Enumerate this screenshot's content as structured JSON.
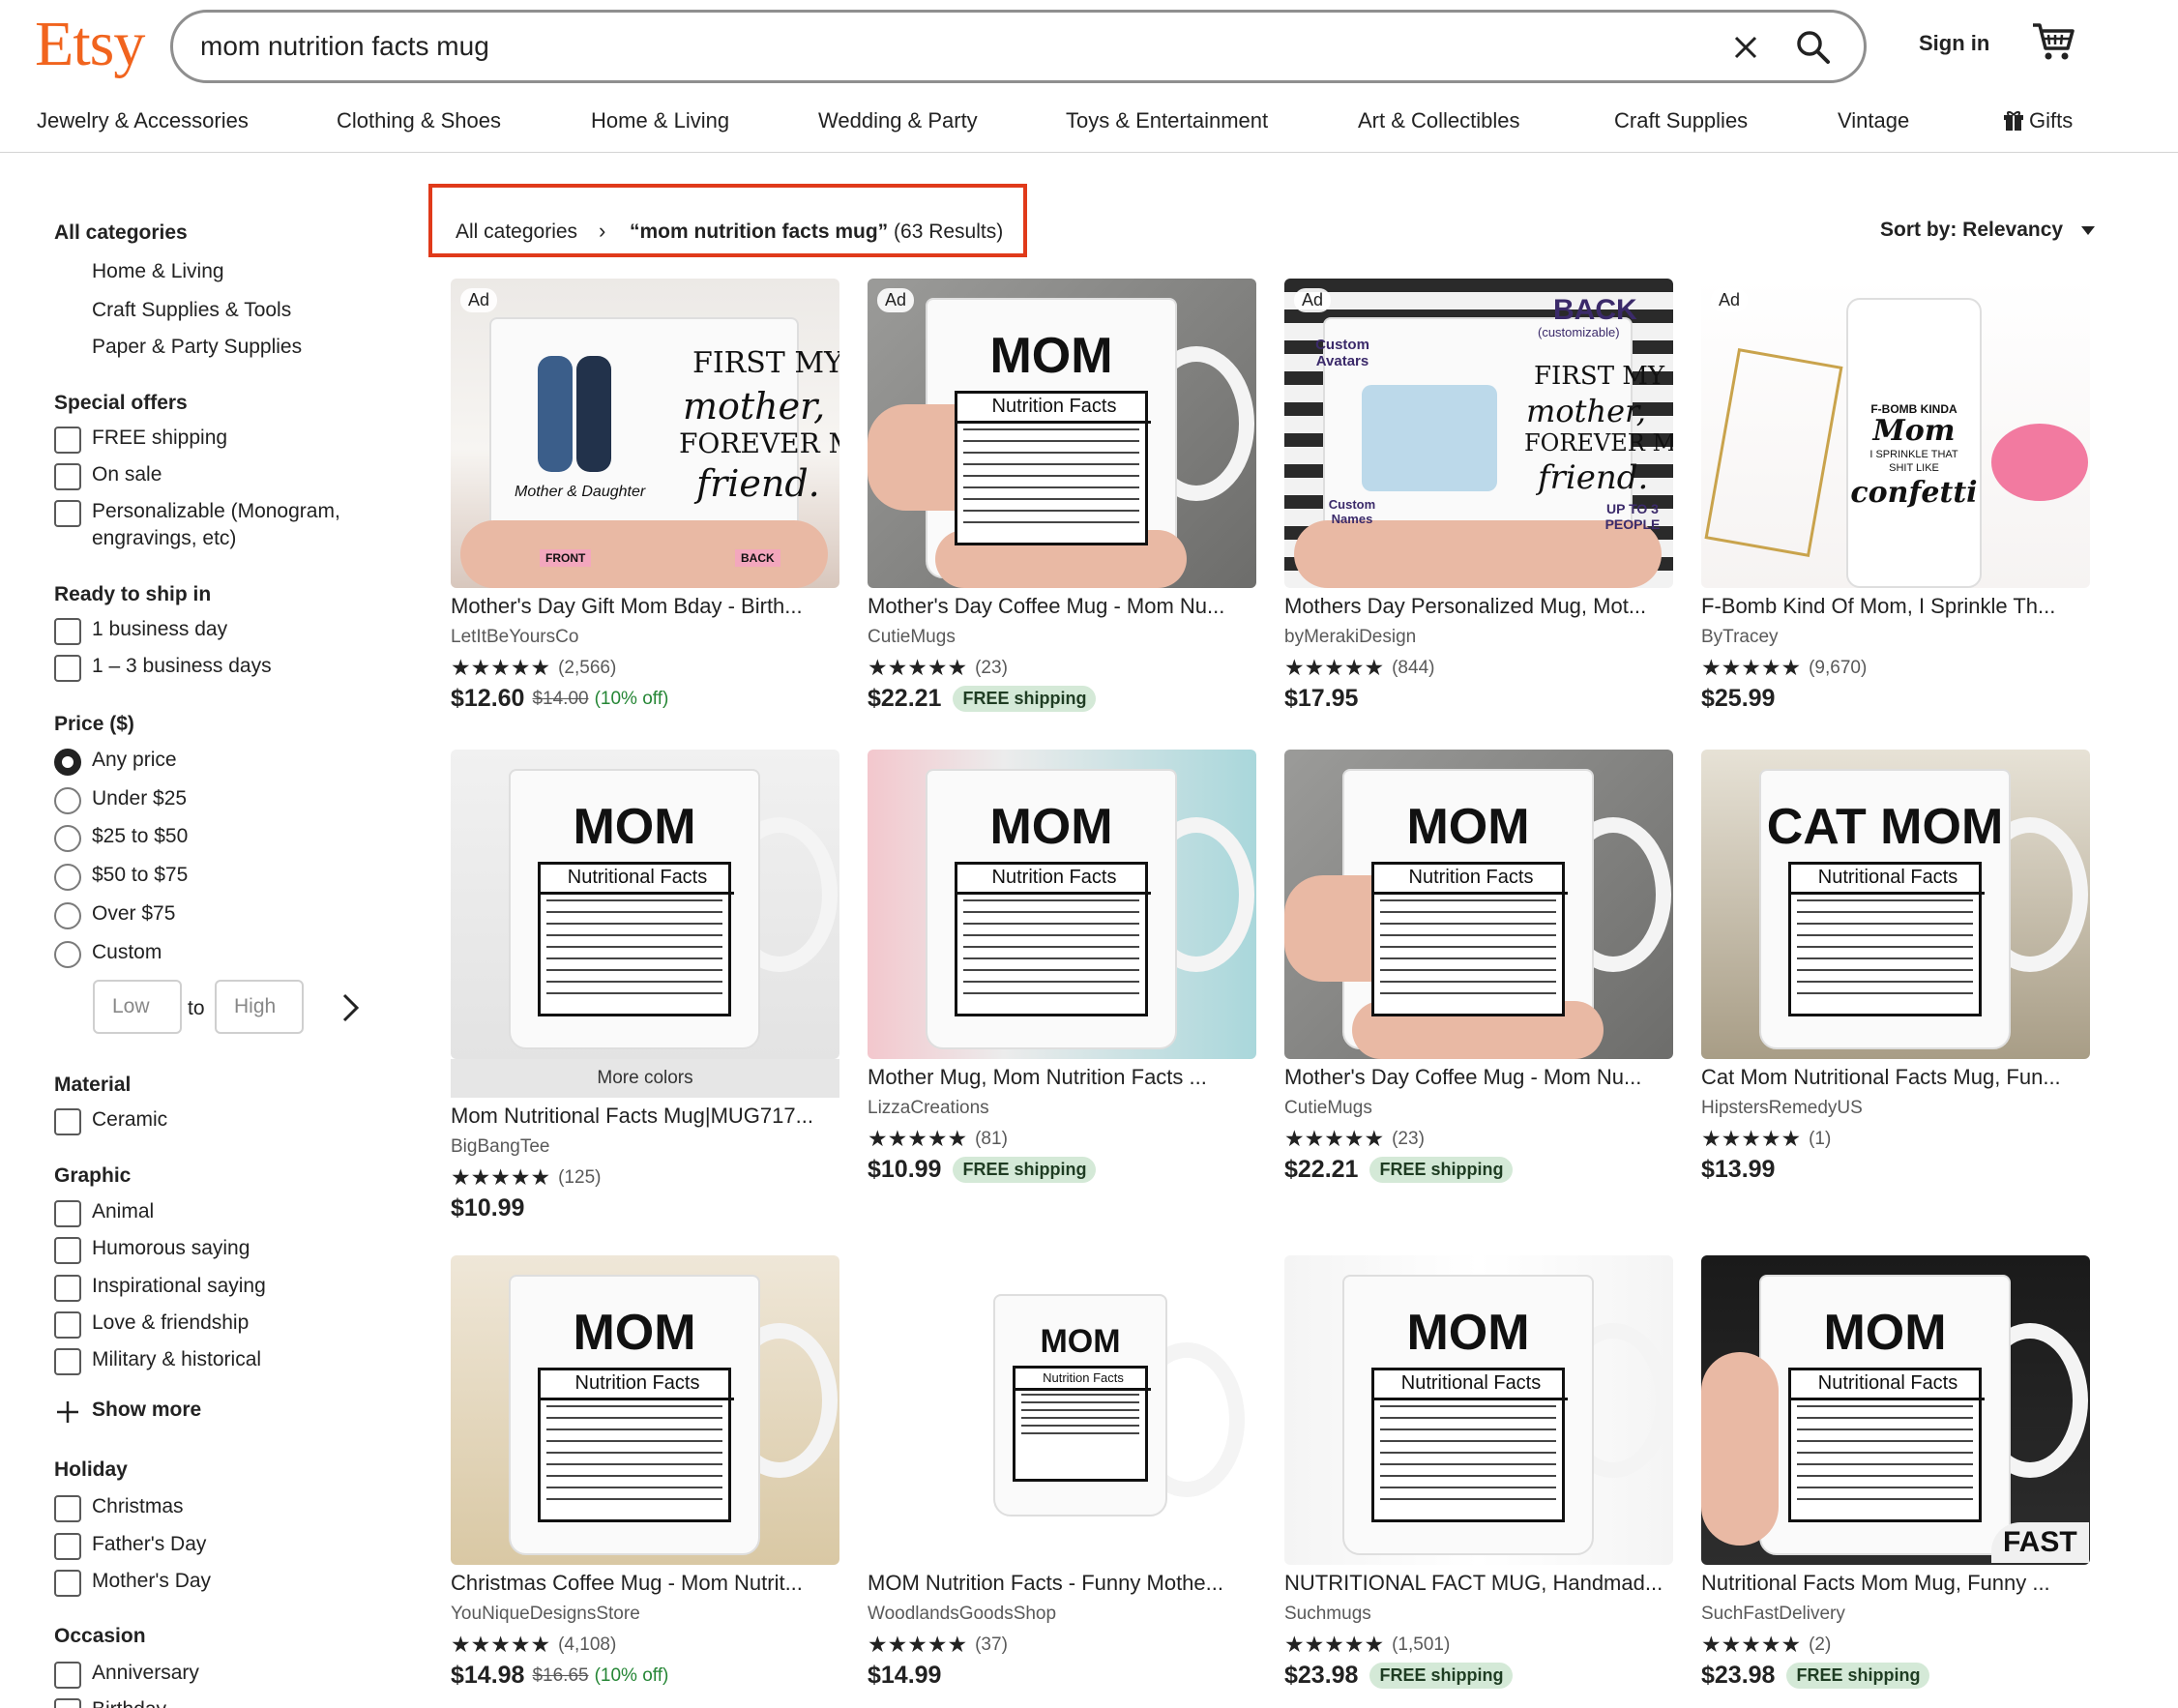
{
  "header": {
    "logo": "Etsy",
    "search_value": "mom nutrition facts mug",
    "sign_in": "Sign in"
  },
  "nav": [
    "Jewelry & Accessories",
    "Clothing & Shoes",
    "Home & Living",
    "Wedding & Party",
    "Toys & Entertainment",
    "Art & Collectibles",
    "Craft Supplies",
    "Vintage",
    "Gifts"
  ],
  "breadcrumb": {
    "root": "All categories",
    "query": "“mom nutrition facts mug”",
    "count": "(63 Results)"
  },
  "sort": "Sort by: Relevancy",
  "sidebar": {
    "all_categories": "All categories",
    "categories": [
      "Home & Living",
      "Craft Supplies & Tools",
      "Paper & Party Supplies"
    ],
    "special_offers": {
      "title": "Special offers",
      "options": [
        "FREE shipping",
        "On sale",
        "Personalizable (Monogram,",
        "engravings, etc)"
      ]
    },
    "ready_to_ship": {
      "title": "Ready to ship in",
      "options": [
        "1 business day",
        "1 – 3 business days"
      ]
    },
    "price": {
      "title": "Price ($)",
      "options": [
        "Any price",
        "Under $25",
        "$25 to $50",
        "$50 to $75",
        "Over $75",
        "Custom"
      ],
      "low": "Low",
      "to": "to",
      "high": "High"
    },
    "material": {
      "title": "Material",
      "options": [
        "Ceramic"
      ]
    },
    "graphic": {
      "title": "Graphic",
      "options": [
        "Animal",
        "Humorous saying",
        "Inspirational saying",
        "Love & friendship",
        "Military & historical"
      ],
      "show_more": "Show more"
    },
    "holiday": {
      "title": "Holiday",
      "options": [
        "Christmas",
        "Father's Day",
        "Mother's Day"
      ]
    },
    "occasion": {
      "title": "Occasion",
      "options": [
        "Anniversary",
        "Birthday"
      ]
    }
  },
  "listings": [
    {
      "ad": "Ad",
      "title": "Mother's Day Gift Mom Bday - Birth...",
      "shop": "LetItBeYoursCo",
      "stars": "★★★★★",
      "reviews": "(2,566)",
      "price": "$12.60",
      "orig": "$14.00",
      "off": "(10% off)",
      "free": ""
    },
    {
      "ad": "Ad",
      "title": "Mother's Day Coffee Mug - Mom Nu...",
      "shop": "CutieMugs",
      "stars": "★★★★★",
      "reviews": "(23)",
      "price": "$22.21",
      "orig": "",
      "off": "",
      "free": "FREE shipping"
    },
    {
      "ad": "Ad",
      "title": "Mothers Day Personalized Mug, Mot...",
      "shop": "byMerakiDesign",
      "stars": "★★★★★",
      "reviews": "(844)",
      "price": "$17.95",
      "orig": "",
      "off": "",
      "free": ""
    },
    {
      "ad": "Ad",
      "title": "F-Bomb Kind Of Mom, I Sprinkle Th...",
      "shop": "ByTracey",
      "stars": "★★★★★",
      "reviews": "(9,670)",
      "price": "$25.99",
      "orig": "",
      "off": "",
      "free": ""
    },
    {
      "ad": "",
      "title": "Mom Nutritional Facts Mug|MUG717...",
      "shop": "BigBangTee",
      "stars": "★★★★★",
      "reviews": "(125)",
      "price": "$10.99",
      "orig": "",
      "off": "",
      "free": "",
      "more_colors": "More colors"
    },
    {
      "ad": "",
      "title": "Mother Mug, Mom Nutrition Facts ...",
      "shop": "LizzaCreations",
      "stars": "★★★★★",
      "reviews": "(81)",
      "price": "$10.99",
      "orig": "",
      "off": "",
      "free": "FREE shipping"
    },
    {
      "ad": "",
      "title": "Mother's Day Coffee Mug - Mom Nu...",
      "shop": "CutieMugs",
      "stars": "★★★★★",
      "reviews": "(23)",
      "price": "$22.21",
      "orig": "",
      "off": "",
      "free": "FREE shipping"
    },
    {
      "ad": "",
      "title": "Cat Mom Nutritional Facts Mug, Fun...",
      "shop": "HipstersRemedyUS",
      "stars": "★★★★★",
      "reviews": "(1)",
      "price": "$13.99",
      "orig": "",
      "off": "",
      "free": ""
    },
    {
      "ad": "",
      "title": "Christmas Coffee Mug - Mom Nutrit...",
      "shop": "YouNiqueDesignsStore",
      "stars": "★★★★★",
      "reviews": "(4,108)",
      "price": "$14.98",
      "orig": "$16.65",
      "off": "(10% off)",
      "free": ""
    },
    {
      "ad": "",
      "title": "MOM Nutrition Facts - Funny Mothe...",
      "shop": "WoodlandsGoodsShop",
      "stars": "★★★★★",
      "reviews": "(37)",
      "price": "$14.99",
      "orig": "",
      "off": "",
      "free": ""
    },
    {
      "ad": "",
      "title": "NUTRITIONAL FACT MUG, Handmad...",
      "shop": "Suchmugs",
      "stars": "★★★★★",
      "reviews": "(1,501)",
      "price": "$23.98",
      "orig": "",
      "off": "",
      "free": "FREE shipping"
    },
    {
      "ad": "",
      "title": "Nutritional Facts Mom Mug, Funny ...",
      "shop": "SuchFastDelivery",
      "stars": "★★★★★",
      "reviews": "(2)",
      "price": "$23.98",
      "orig": "",
      "off": "",
      "free": "FREE shipping"
    }
  ],
  "mug_text": {
    "m0a": "FIRST MY",
    "m0b": "mother,",
    "m0c": "FOREVER MY",
    "m0d": "friend.",
    "m0e": "Mother & Daughter",
    "m0f": "FRONT",
    "m0g": "BACK",
    "m1a": "MOM",
    "m1b": "Nutrition Facts",
    "m2a": "BACK",
    "m2b": "(customizable)",
    "m2c": "Custom Avatars",
    "m2d": "FIRST MY",
    "m2e": "mother,",
    "m2f": "FOREVER MY",
    "m2g": "friend.",
    "m2h": "Custom Names",
    "m2i": "UP TO 3 PEOPLE",
    "m3a": "F-BOMB KINDA",
    "m3b": "Mom",
    "m3c": "I SPRINKLE THAT",
    "m3d": "SHIT LIKE",
    "m3e": "confetti",
    "m4a": "MOM",
    "m4b": "Nutritional Facts",
    "m5a": "MOM",
    "m5b": "Nutrition Facts",
    "m6a": "MOM",
    "m6b": "Nutrition Facts",
    "m7a": "CAT MOM",
    "m7b": "Nutritional Facts",
    "m8a": "MOM",
    "m8b": "Nutrition Facts",
    "m9a": "MOM",
    "m9b": "Nutrition Facts",
    "m10a": "MOM",
    "m10b": "Nutritional Facts",
    "m11a": "MOM",
    "m11b": "Nutritional Facts",
    "m11c": "FAST"
  },
  "colors": {
    "brand": "#f1641e",
    "highlight": "#e03a1a",
    "free_bg": "#d4e9d7",
    "discount": "#258635"
  }
}
